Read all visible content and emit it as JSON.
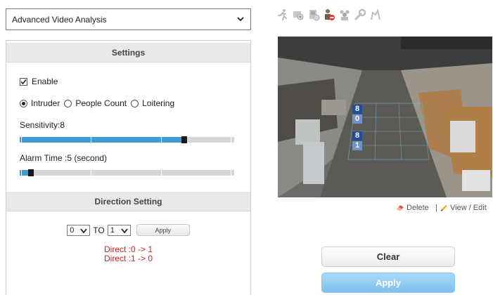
{
  "mode_select": {
    "value": "Advanced Video Analysis"
  },
  "settings": {
    "header": "Settings",
    "enable_label": "Enable",
    "enable_checked": true,
    "modes": [
      {
        "label": "Intruder",
        "selected": true
      },
      {
        "label": "People Count",
        "selected": false
      },
      {
        "label": "Loitering",
        "selected": false
      }
    ],
    "sensitivity_label": "Sensitivity:8",
    "sensitivity_value": 8,
    "sensitivity_max": 10,
    "alarm_label": "Alarm Time :5 (second)",
    "alarm_value": 5
  },
  "direction": {
    "header": "Direction Setting",
    "from_value": "0",
    "to_label": "TO",
    "to_value": "1",
    "apply_label": "Apply",
    "rules": [
      "Direct :0 -> 1",
      "Direct :1 -> 0"
    ]
  },
  "toolbar": {
    "icons": [
      "running-person-icon",
      "camera-settings-icon",
      "camera-alert-icon",
      "person-block-icon",
      "people-group-icon",
      "wrench-icon",
      "tamper-icon"
    ]
  },
  "video": {
    "zone_labels": [
      "8",
      "0",
      "8",
      "1"
    ]
  },
  "links": {
    "delete_label": "Delete",
    "separator": "|",
    "view_edit_label": "View / Edit"
  },
  "buttons": {
    "clear_label": "Clear",
    "apply_label": "Apply"
  },
  "colors": {
    "slider_fill": "#3f9bd3",
    "direct_text": "#d02020",
    "apply_button": "#8ccbf3",
    "zone_label_bg": "#1f4f9a"
  }
}
